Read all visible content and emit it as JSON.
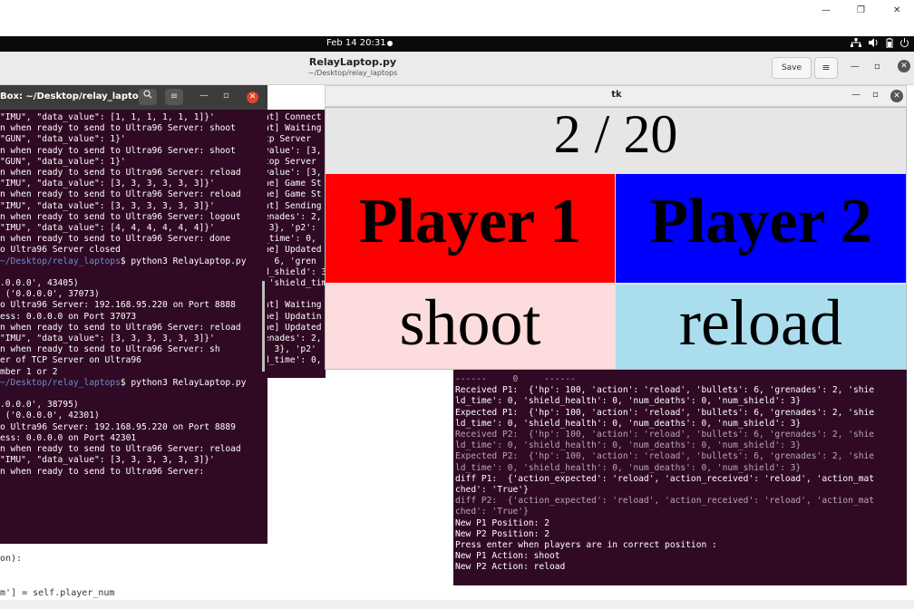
{
  "system": {
    "date_time": "Feb 14  20:31",
    "tray_icons": [
      "network-icon",
      "volume-icon",
      "battery-icon",
      "power-icon"
    ]
  },
  "gedit": {
    "title": "RelayLaptop.py",
    "subtitle": "~/Desktop/relay_laptops",
    "save_label": "Save",
    "menu_icon": "≡"
  },
  "top_window_controls": {
    "minimize": "—",
    "maximize": "❐",
    "close": "✕"
  },
  "editor_lines": [
    "on):",
    "m'] = self.player_num"
  ],
  "terminal": {
    "title": "Box: ~/Desktop/relay_laptops",
    "lines": [
      "\"IMU\", \"data_value\": [1, 1, 1, 1, 1, 1]}'",
      "n when ready to send to Ultra96 Server: shoot",
      "\"GUN\", \"data_value\": 1}'",
      "n when ready to send to Ultra96 Server: shoot",
      "\"GUN\", \"data_value\": 1}'",
      "n when ready to send to Ultra96 Server: reload",
      "\"IMU\", \"data_value\": [3, 3, 3, 3, 3, 3]}'",
      "n when ready to send to Ultra96 Server: reload",
      "\"IMU\", \"data_value\": [3, 3, 3, 3, 3, 3]}'",
      "n when ready to send to Ultra96 Server: logout",
      "\"IMU\", \"data_value\": [4, 4, 4, 4, 4, 4]}'",
      "n when ready to send to Ultra96 Server: done",
      "o Ultra96 Server closed",
      "~/Desktop/relay_laptops$ python3 RelayLaptop.py",
      "",
      ".0.0.0', 43405)",
      " ('0.0.0.0', 37073)",
      "o Ultra96 Server: 192.168.95.220 on Port 8888",
      "ess: 0.0.0.0 on Port 37073",
      "n when ready to send to Ultra96 Server: reload",
      "\"IMU\", \"data_value\": [3, 3, 3, 3, 3, 3]}'",
      "n when ready to send to Ultra96 Server: sh",
      "er of TCP Server on Ultra96",
      "mber 1 or 2",
      "~/Desktop/relay_laptops$ python3 RelayLaptop.py",
      "",
      ".0.0.0', 38795)",
      " ('0.0.0.0', 42301)",
      "o Ultra96 Server: 192.168.95.220 on Port 8889",
      "ess: 0.0.0.0 on Port 42301",
      "n when ready to send to Ultra96 Server: reload",
      "\"IMU\", \"data_value\": [3, 3, 3, 3, 3, 3]}'",
      "n when ready to send to Ultra96 Server: "
    ]
  },
  "terminal2": {
    "lines": [
      "nt] Connect",
      "nt] Waiting",
      "tp Server",
      "value': [3,",
      "top Server",
      "value': [3,",
      "ne] Game St",
      "ne] Game St",
      "nt] Sending",
      "enades': 2,",
      " 3}, 'p2':",
      "_time': 0,",
      "ne] Updated",
      ": 6, 'gren",
      "d_shield': 3",
      " 'shield_tim",
      "",
      "nt] Waiting",
      "ne] Updatin",
      "ne] Updated",
      "enades': 2,",
      ": 3}, 'p2'",
      "d_time': 0,"
    ]
  },
  "tk": {
    "title": "tk",
    "round": "2 / 20",
    "player1_label": "Player 1",
    "player2_label": "Player 2",
    "player1_action": "shoot",
    "player2_action": "reload",
    "colors": {
      "p1": "#ff0000",
      "p2": "#0000ff",
      "a1": "#fcdcdc",
      "a2": "#aadeef",
      "score_bg": "#e6e6e6"
    }
  },
  "terminal3": {
    "lines": [
      {
        "t": "------     0     ------",
        "dim": true
      },
      {
        "t": "Received P1:  {'hp': 100, 'action': 'reload', 'bullets': 6, 'grenades': 2, 'shie",
        "dim": false
      },
      {
        "t": "ld_time': 0, 'shield_health': 0, 'num_deaths': 0, 'num_shield': 3}",
        "dim": false
      },
      {
        "t": "Expected P1:  {'hp': 100, 'action': 'reload', 'bullets': 6, 'grenades': 2, 'shie",
        "dim": false
      },
      {
        "t": "ld_time': 0, 'shield_health': 0, 'num_deaths': 0, 'num_shield': 3}",
        "dim": false
      },
      {
        "t": "Received P2:  {'hp': 100, 'action': 'reload', 'bullets': 6, 'grenades': 2, 'shie",
        "dim": true
      },
      {
        "t": "ld_time': 0, 'shield_health': 0, 'num_deaths': 0, 'num_shield': 3}",
        "dim": true
      },
      {
        "t": "Expected P2:  {'hp': 100, 'action': 'reload', 'bullets': 6, 'grenades': 2, 'shie",
        "dim": true
      },
      {
        "t": "ld_time': 0, 'shield_health': 0, 'num_deaths': 0, 'num_shield': 3}",
        "dim": true
      },
      {
        "t": "diff P1:  {'action_expected': 'reload', 'action_received': 'reload', 'action_mat",
        "dim": false
      },
      {
        "t": "ched': 'True'}",
        "dim": false
      },
      {
        "t": "diff P2:  {'action_expected': 'reload', 'action_received': 'reload', 'action_mat",
        "dim": true
      },
      {
        "t": "ched': 'True'}",
        "dim": true
      },
      {
        "t": "New P1 Position: 2",
        "dim": false
      },
      {
        "t": "New P2 Position: 2",
        "dim": false
      },
      {
        "t": "Press enter when players are in correct position :",
        "dim": false
      },
      {
        "t": "New P1 Action: shoot",
        "dim": false
      },
      {
        "t": "New P2 Action: reload",
        "dim": false
      },
      {
        "t": "",
        "dim": false
      }
    ]
  }
}
